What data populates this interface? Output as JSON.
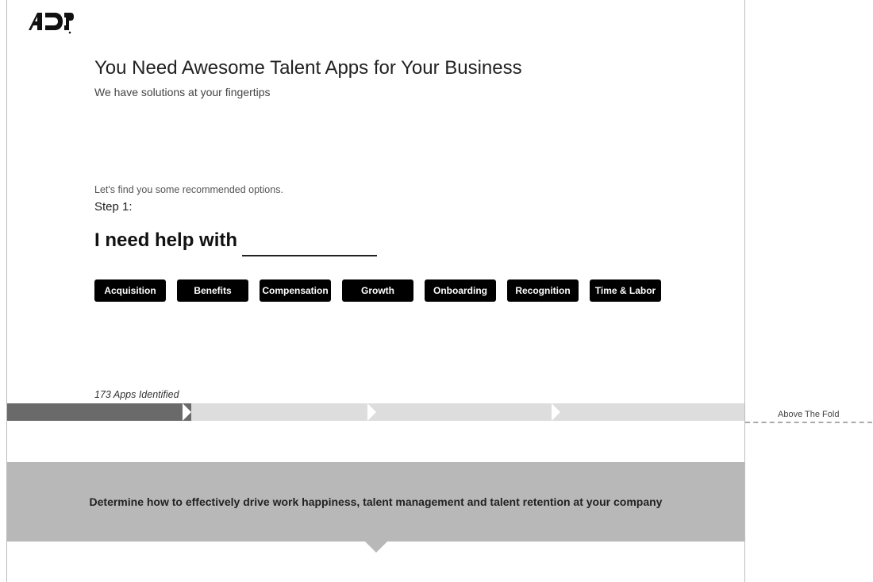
{
  "brand": "ADP",
  "header": {
    "headline": "You Need Awesome Talent Apps for Your Business",
    "subhead": "We have solutions at your fingertips"
  },
  "finder": {
    "lead": "Let's find you some recommended options.",
    "step_label": "Step 1:",
    "prompt": "I need help with"
  },
  "categories": [
    "Acquisition",
    "Benefits",
    "Compensation",
    "Growth",
    "Onboarding",
    "Recognition",
    "Time & Labor"
  ],
  "results": {
    "count_text": "173 Apps Identified"
  },
  "stepper": {
    "total": 4,
    "active_index": 0
  },
  "banner": {
    "text": "Determine how to effectively drive work happiness, talent management and talent retention at your company"
  },
  "annotation": {
    "fold_label": "Above The Fold"
  }
}
